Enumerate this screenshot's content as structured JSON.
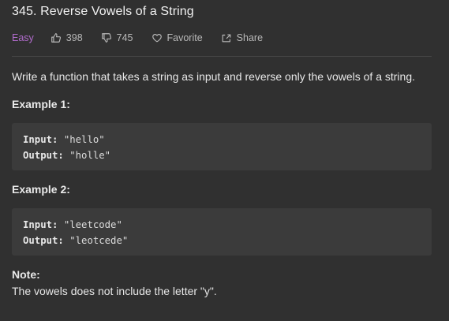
{
  "problem": {
    "title": "345. Reverse Vowels of a String",
    "difficulty": "Easy",
    "likes": "398",
    "dislikes": "745",
    "favorite_label": "Favorite",
    "share_label": "Share"
  },
  "description": "Write a function that takes a string as input and reverse only the vowels of a string.",
  "examples": [
    {
      "heading": "Example 1:",
      "input_label": "Input:",
      "input_value": "\"hello\"",
      "output_label": "Output:",
      "output_value": "\"holle\""
    },
    {
      "heading": "Example 2:",
      "input_label": "Input:",
      "input_value": "\"leetcode\"",
      "output_label": "Output:",
      "output_value": "\"leotcede\""
    }
  ],
  "note": {
    "heading": "Note:",
    "text": "The vowels does not include the letter \"y\"."
  },
  "colors": {
    "background": "#303030",
    "difficulty_easy": "#b06bcb",
    "code_background": "#3b3b3b"
  }
}
